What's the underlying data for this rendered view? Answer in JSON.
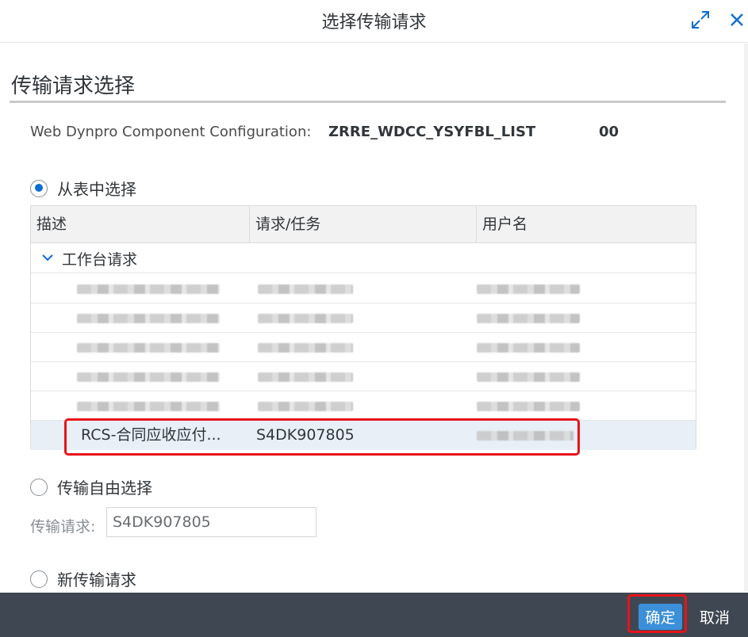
{
  "dialog": {
    "title": "选择传输请求",
    "fullscreen_icon": "expand-icon",
    "close_icon": "close-icon"
  },
  "section": {
    "title": "传输请求选择"
  },
  "config": {
    "label": "Web Dynpro Component Configuration:",
    "name": "ZRRE_WDCC_YSYFBL_LIST",
    "version": "00"
  },
  "options": {
    "from_table": "从表中选择",
    "free_select": "传输自由选择",
    "new_request": "新传输请求",
    "selected": "from_table"
  },
  "table": {
    "headers": [
      "描述",
      "请求/任务",
      "用户名"
    ],
    "group_label": "工作台请求",
    "rows": [
      {
        "desc": "",
        "request": "",
        "user": ""
      },
      {
        "desc": "",
        "request": "",
        "user": ""
      },
      {
        "desc": "",
        "request": "",
        "user": ""
      },
      {
        "desc": "",
        "request": "",
        "user": ""
      },
      {
        "desc": "",
        "request": "",
        "user": ""
      },
      {
        "desc": "RCS-合同应收应付...",
        "request": "S4DK907805",
        "user": "",
        "selected": true
      }
    ]
  },
  "free_select": {
    "label": "传输请求:",
    "value": "S4DK907805"
  },
  "footer": {
    "ok": "确定",
    "cancel": "取消"
  },
  "colors": {
    "accent": "#0a6ed1",
    "footer_bg": "#3f4852",
    "highlight": "#e8141c",
    "selected_row": "#e8eff6"
  }
}
